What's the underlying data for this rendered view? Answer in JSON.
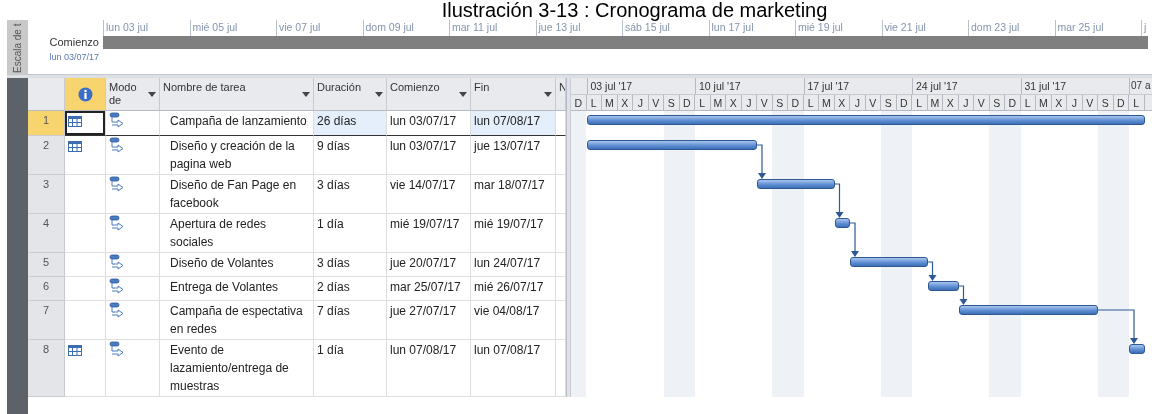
{
  "title": "Ilustración 3-13 : Cronograma de marketing",
  "timeline": {
    "side_label": "Escala de t",
    "start_label": "Comienzo",
    "start_date": "lun 03/07/17",
    "ticks": [
      "lun 03 jul",
      "mié 05 jul",
      "vie 07 jul",
      "dom 09 jul",
      "mar 11 jul",
      "jue 13 jul",
      "sáb 15 jul",
      "lun 17 jul",
      "mié 19 jul",
      "vie 21 jul",
      "dom 23 jul",
      "mar 25 jul",
      "j"
    ]
  },
  "columns": [
    {
      "kind": "indicator"
    },
    {
      "kind": "text",
      "label": "Modo de",
      "filter": true
    },
    {
      "kind": "text",
      "label": "Nombre de tarea",
      "filter": true
    },
    {
      "kind": "text",
      "label": "Duración",
      "filter": true
    },
    {
      "kind": "text",
      "label": "Comienzo",
      "filter": true
    },
    {
      "kind": "text",
      "label": "Fin",
      "filter": true
    },
    {
      "kind": "text",
      "label": "N"
    }
  ],
  "gantt": {
    "weeks": [
      "03 jul '17",
      "10 jul '17",
      "17 jul '17",
      "24 jul '17",
      "31 jul '17",
      "07 a"
    ],
    "days": [
      "D",
      "L",
      "M",
      "X",
      "J",
      "V",
      "S",
      "D",
      "L",
      "M",
      "X",
      "J",
      "V",
      "S",
      "D",
      "L",
      "M",
      "X",
      "J",
      "V",
      "S",
      "D",
      "L",
      "M",
      "X",
      "J",
      "V",
      "S",
      "D",
      "L",
      "M",
      "X",
      "J",
      "V",
      "S",
      "D",
      "L"
    ]
  },
  "tasks": [
    {
      "id": "1",
      "calendar": true,
      "name": "Campaña de lanzamiento",
      "duration": "26 días",
      "start": "lun 03/07/17",
      "finish": "lun 07/08/17",
      "selected": true
    },
    {
      "id": "2",
      "calendar": true,
      "name": "Diseño y creación de la pagina web",
      "duration": "9 días",
      "start": "lun 03/07/17",
      "finish": "jue 13/07/17",
      "selected": false
    },
    {
      "id": "3",
      "calendar": false,
      "name": "Diseño de Fan Page en facebook",
      "duration": "3 días",
      "start": "vie 14/07/17",
      "finish": "mar 18/07/17",
      "selected": false
    },
    {
      "id": "4",
      "calendar": false,
      "name": "Apertura de redes sociales",
      "duration": "1 día",
      "start": "mié 19/07/17",
      "finish": "mié 19/07/17",
      "selected": false
    },
    {
      "id": "5",
      "calendar": false,
      "name": "Diseño de Volantes",
      "duration": "3 días",
      "start": "jue 20/07/17",
      "finish": "lun 24/07/17",
      "selected": false
    },
    {
      "id": "6",
      "calendar": false,
      "name": "Entrega de Volantes",
      "duration": "2 días",
      "start": "mar 25/07/17",
      "finish": "mié 26/07/17",
      "selected": false
    },
    {
      "id": "7",
      "calendar": false,
      "name": "Campaña de espectativa en redes",
      "duration": "7 días",
      "start": "jue 27/07/17",
      "finish": "vie 04/08/17",
      "selected": false
    },
    {
      "id": "8",
      "calendar": true,
      "name": "Evento de lazamiento/entrega de muestras",
      "duration": "1 día",
      "start": "lun 07/08/17",
      "finish": "lun 07/08/17",
      "selected": false
    }
  ]
}
